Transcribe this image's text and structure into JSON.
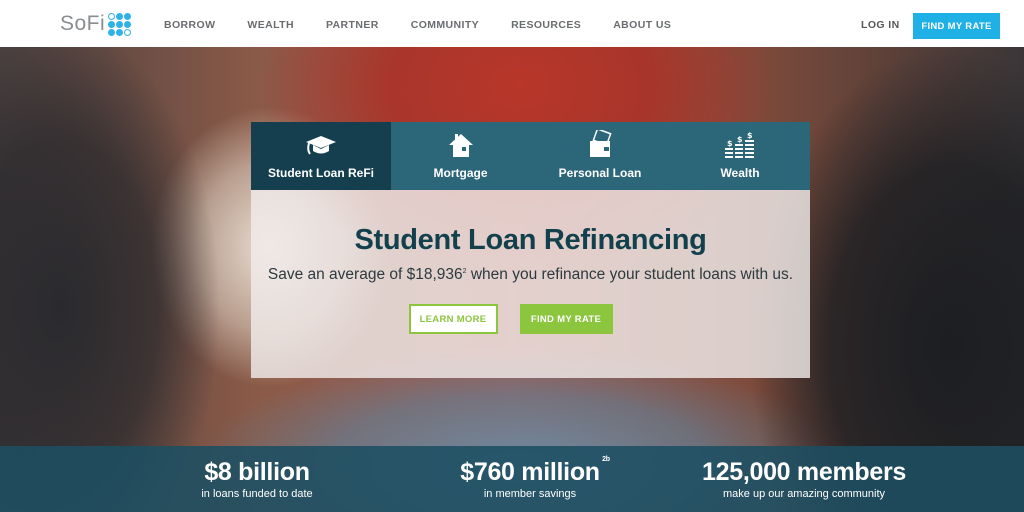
{
  "header": {
    "logo_text": "SoFi",
    "nav": [
      "BORROW",
      "WEALTH",
      "PARTNER",
      "COMMUNITY",
      "RESOURCES",
      "ABOUT US"
    ],
    "login": "LOG IN",
    "find_rate": "FIND MY RATE"
  },
  "tabs": [
    {
      "label": "Student Loan ReFi",
      "icon": "graduation-cap-icon",
      "active": true
    },
    {
      "label": "Mortgage",
      "icon": "house-icon"
    },
    {
      "label": "Personal Loan",
      "icon": "wallet-icon"
    },
    {
      "label": "Wealth",
      "icon": "coin-stacks-icon"
    }
  ],
  "panel": {
    "title": "Student Loan Refinancing",
    "subtitle_pre": "Save an average of $18,936",
    "subtitle_sup": "2",
    "subtitle_post": " when you refinance your student loans with us.",
    "learn_more": "LEARN MORE",
    "find_rate": "FIND MY RATE"
  },
  "stats": [
    {
      "value": "$8 billion",
      "caption": "in loans funded to date"
    },
    {
      "value": "$760 million",
      "sup": "2b",
      "caption": "in member savings"
    },
    {
      "value": "125,000 members",
      "caption": "make up our amazing community"
    }
  ],
  "colors": {
    "accent_blue": "#1fb0e6",
    "accent_green": "#8cc63f",
    "tab_bg": "#2c6679",
    "tab_active": "#153f4e"
  }
}
